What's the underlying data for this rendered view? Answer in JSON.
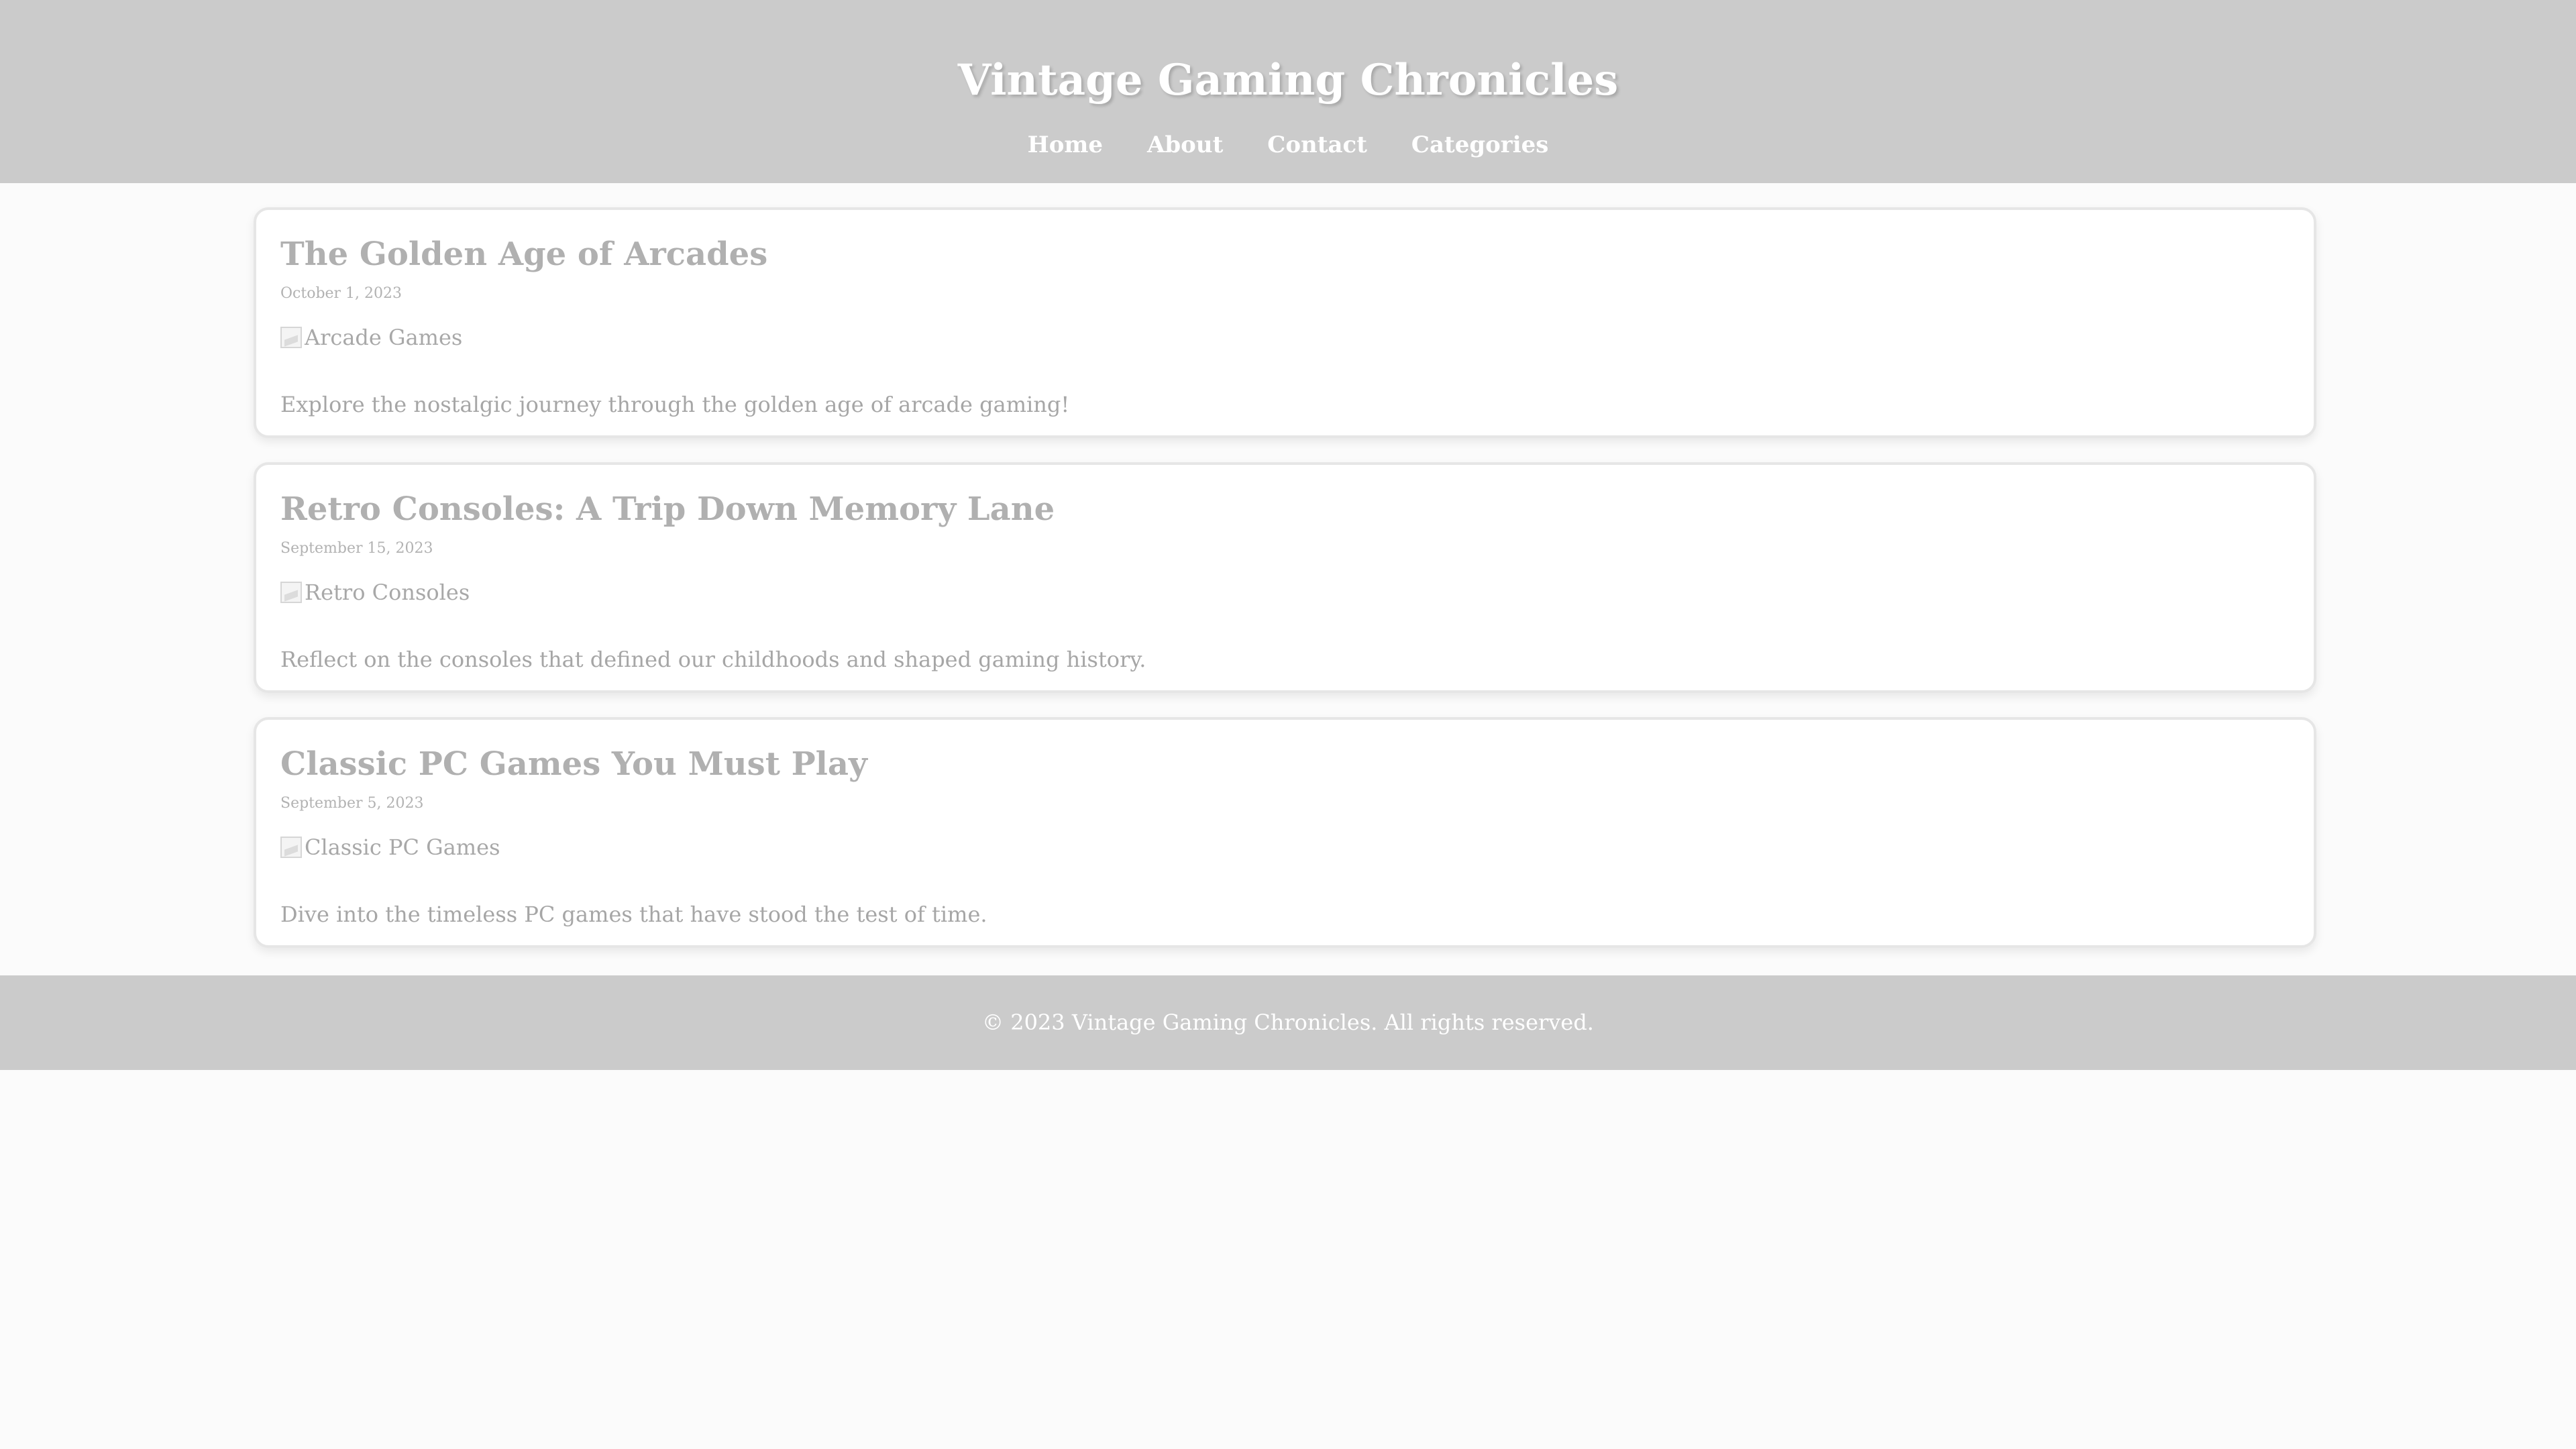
{
  "header": {
    "title": "Vintage Gaming Chronicles",
    "nav": [
      "Home",
      "About",
      "Contact",
      "Categories"
    ]
  },
  "posts": [
    {
      "title": "The Golden Age of Arcades",
      "date": "October 1, 2023",
      "image_alt": "Arcade Games",
      "excerpt": "Explore the nostalgic journey through the golden age of arcade gaming!"
    },
    {
      "title": "Retro Consoles: A Trip Down Memory Lane",
      "date": "September 15, 2023",
      "image_alt": "Retro Consoles",
      "excerpt": "Reflect on the consoles that defined our childhoods and shaped gaming history."
    },
    {
      "title": "Classic PC Games You Must Play",
      "date": "September 5, 2023",
      "image_alt": "Classic PC Games",
      "excerpt": "Dive into the timeless PC games that have stood the test of time."
    }
  ],
  "footer": {
    "text": "© 2023 Vintage Gaming Chronicles. All rights reserved."
  },
  "colors": {
    "header_bg": "#cbcbcb",
    "page_bg": "#fbfbfb",
    "card_bg": "#ffffff",
    "heading_text": "#b0b0b0",
    "header_text": "#ffffff"
  },
  "icons": {
    "post_image": "broken-image-icon"
  }
}
